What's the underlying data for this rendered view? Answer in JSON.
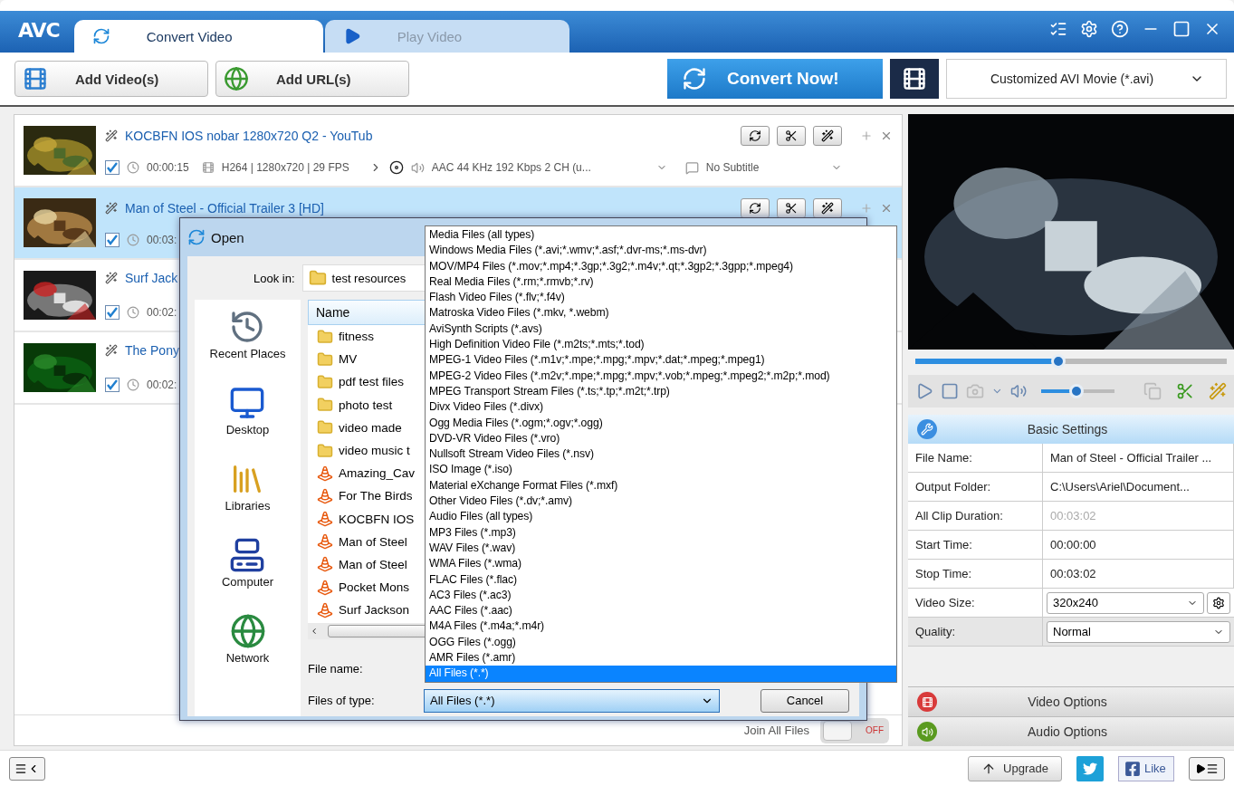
{
  "app": {
    "logo": "AVC",
    "tabs": [
      {
        "label": "Convert Video",
        "selected": true
      },
      {
        "label": "Play Video",
        "selected": false
      }
    ]
  },
  "toolbar": {
    "buttons": [
      "Add Video(s)",
      "Add URL(s)"
    ],
    "convert": "Convert Now!",
    "profile": "Customized AVI Movie (*.avi)"
  },
  "videos": [
    {
      "title": "KOCBFN IOS nobar 1280x720 Q2 - YouTub",
      "checked": true,
      "selected": false,
      "duration": "00:00:15",
      "video_info": "H264 | 1280x720 | 29 FPS",
      "audio": "AAC 44 KHz 192 Kbps 2 CH (u...",
      "subtitle": "No Subtitle"
    },
    {
      "title": "Man of Steel - Official Trailer 3 [HD]",
      "checked": true,
      "selected": true,
      "duration": "00:03:"
    },
    {
      "title": "Surf Jack",
      "checked": true,
      "selected": false,
      "duration": "00:02:"
    },
    {
      "title": "The Pony",
      "checked": true,
      "selected": false,
      "duration": "00:02:"
    }
  ],
  "join": {
    "label": "Join All Files",
    "state": "OFF",
    "on": false
  },
  "player": {
    "seek": {
      "level": 0.46
    },
    "volume": {
      "level": 0.48
    }
  },
  "settings": {
    "title": "Basic Settings",
    "rows": [
      {
        "label": "File Name:",
        "value": "Man of Steel - Official Trailer ...",
        "kind": "text"
      },
      {
        "label": "Output Folder:",
        "value": "C:\\Users\\Ariel\\Document...",
        "kind": "text"
      },
      {
        "label": "All Clip Duration:",
        "value": "00:03:02",
        "kind": "dim"
      },
      {
        "label": "Start Time:",
        "value": "00:00:00",
        "kind": "text"
      },
      {
        "label": "Stop Time:",
        "value": "00:03:02",
        "kind": "text"
      },
      {
        "label": "Video Size:",
        "value": "320x240",
        "kind": "select",
        "gear": true
      },
      {
        "label": "Quality:",
        "value": "Normal",
        "kind": "select",
        "gear": false
      }
    ],
    "sections": [
      {
        "label": "Video Options",
        "kind": "video"
      },
      {
        "label": "Audio Options",
        "kind": "audio"
      }
    ]
  },
  "footer": {
    "upgrade": "Upgrade",
    "like": "Like"
  },
  "dialog": {
    "title": "Open",
    "look_in_label": "Look in:",
    "look_in": "test resources",
    "places": [
      "Recent Places",
      "Desktop",
      "Libraries",
      "Computer",
      "Network"
    ],
    "column": "Name",
    "files": [
      {
        "name": "fitness",
        "kind": "folder"
      },
      {
        "name": "MV",
        "kind": "folder"
      },
      {
        "name": "pdf test files",
        "kind": "folder"
      },
      {
        "name": "photo test",
        "kind": "folder"
      },
      {
        "name": "video made",
        "kind": "folder"
      },
      {
        "name": "video music t",
        "kind": "folder"
      },
      {
        "name": "Amazing_Cav",
        "kind": "video"
      },
      {
        "name": "For The Birds",
        "kind": "video"
      },
      {
        "name": "KOCBFN IOS",
        "kind": "video"
      },
      {
        "name": "Man of Steel",
        "kind": "video"
      },
      {
        "name": "Man of Steel",
        "kind": "video"
      },
      {
        "name": "Pocket Mons",
        "kind": "video"
      },
      {
        "name": "Surf Jackson",
        "kind": "video"
      }
    ],
    "file_name_label": "File name:",
    "type_label": "Files of type:",
    "type_value": "All Files (*.*)",
    "cancel": "Cancel",
    "type_options": [
      {
        "label": "Media Files (all types)",
        "selected": false
      },
      {
        "label": "Windows Media Files (*.avi;*.wmv;*.asf;*.dvr-ms;*.ms-dvr)",
        "selected": false
      },
      {
        "label": "MOV/MP4 Files (*.mov;*.mp4;*.3gp;*.3g2;*.m4v;*.qt;*.3gp2;*.3gpp;*.mpeg4)",
        "selected": false
      },
      {
        "label": "Real Media Files (*.rm;*.rmvb;*.rv)",
        "selected": false
      },
      {
        "label": "Flash Video Files (*.flv;*.f4v)",
        "selected": false
      },
      {
        "label": "Matroska Video Files (*.mkv, *.webm)",
        "selected": false
      },
      {
        "label": "AviSynth Scripts (*.avs)",
        "selected": false
      },
      {
        "label": "High Definition Video File (*.m2ts;*.mts;*.tod)",
        "selected": false
      },
      {
        "label": "MPEG-1 Video Files (*.m1v;*.mpe;*.mpg;*.mpv;*.dat;*.mpeg;*.mpeg1)",
        "selected": false
      },
      {
        "label": "MPEG-2 Video Files (*.m2v;*.mpe;*.mpg;*.mpv;*.vob;*.mpeg;*.mpeg2;*.m2p;*.mod)",
        "selected": false
      },
      {
        "label": "MPEG Transport Stream Files (*.ts;*.tp;*.m2t;*.trp)",
        "selected": false
      },
      {
        "label": "Divx Video Files (*.divx)",
        "selected": false
      },
      {
        "label": "Ogg Media Files (*.ogm;*.ogv;*.ogg)",
        "selected": false
      },
      {
        "label": "DVD-VR Video Files (*.vro)",
        "selected": false
      },
      {
        "label": "Nullsoft Stream Video Files (*.nsv)",
        "selected": false
      },
      {
        "label": "ISO Image (*.iso)",
        "selected": false
      },
      {
        "label": "Material eXchange Format Files (*.mxf)",
        "selected": false
      },
      {
        "label": "Other Video Files (*.dv;*.amv)",
        "selected": false
      },
      {
        "label": "Audio Files (all types)",
        "selected": false
      },
      {
        "label": "MP3 Files (*.mp3)",
        "selected": false
      },
      {
        "label": "WAV Files (*.wav)",
        "selected": false
      },
      {
        "label": "WMA Files (*.wma)",
        "selected": false
      },
      {
        "label": "FLAC Files (*.flac)",
        "selected": false
      },
      {
        "label": "AC3 Files (*.ac3)",
        "selected": false
      },
      {
        "label": "AAC Files (*.aac)",
        "selected": false
      },
      {
        "label": "M4A Files (*.m4a;*.m4r)",
        "selected": false
      },
      {
        "label": "OGG Files (*.ogg)",
        "selected": false
      },
      {
        "label": "AMR Files (*.amr)",
        "selected": false
      },
      {
        "label": "All Files (*.*)",
        "selected": true
      }
    ]
  }
}
